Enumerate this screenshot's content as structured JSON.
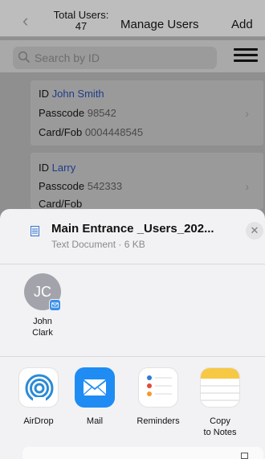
{
  "navbar": {
    "back_icon": "chevron-left-icon",
    "total_label": "Total Users:",
    "total_count": "47",
    "title": "Manage Users",
    "add_label": "Add"
  },
  "search": {
    "placeholder": "Search by ID",
    "icon": "search-icon",
    "menu_icon": "hamburger-menu-icon"
  },
  "users": [
    {
      "id_label": "ID",
      "id_value": "John Smith",
      "passcode_label": "Passcode",
      "passcode_value": "98542",
      "card_label": "Card/Fob",
      "card_value": "0004448545"
    },
    {
      "id_label": "ID",
      "id_value": "Larry",
      "passcode_label": "Passcode",
      "passcode_value": "542333",
      "card_label": "Card/Fob",
      "card_value": ""
    }
  ],
  "share_sheet": {
    "file_name": "Main Entrance _Users_202...",
    "file_meta": "Text Document · 6 KB",
    "close_icon": "close-icon",
    "contact": {
      "initials": "JC",
      "name_line1": "John",
      "name_line2": "Clark"
    },
    "apps": [
      {
        "name": "AirDrop",
        "icon": "airdrop-icon"
      },
      {
        "name": "Mail",
        "icon": "mail-icon"
      },
      {
        "name": "Reminders",
        "icon": "reminders-icon"
      },
      {
        "name_line1": "Copy",
        "name_line2": "to Notes",
        "icon": "notes-icon"
      }
    ]
  },
  "colors": {
    "accent_blue": "#1f3c8a",
    "mail_blue": "#1e8cf3",
    "airdrop_blue": "#2a8bd6",
    "notes_yellow": "#f7c844"
  }
}
